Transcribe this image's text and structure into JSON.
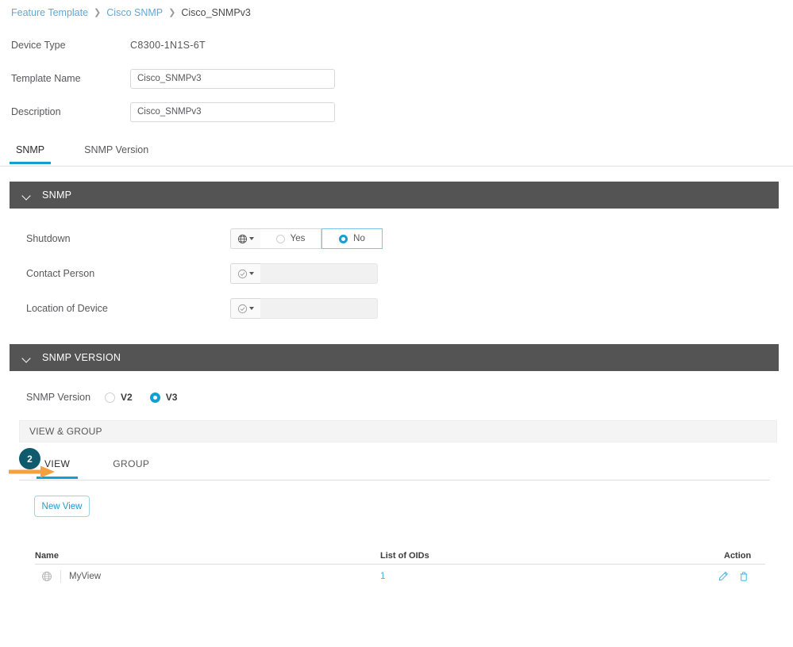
{
  "breadcrumb": {
    "items": [
      {
        "label": "Feature Template",
        "type": "link"
      },
      {
        "label": "Cisco SNMP",
        "type": "link"
      },
      {
        "label": "Cisco_SNMPv3",
        "type": "current"
      }
    ],
    "separator": "❯"
  },
  "meta": {
    "device_type_label": "Device Type",
    "device_type_value": "C8300-1N1S-6T",
    "template_name_label": "Template Name",
    "template_name_value": "Cisco_SNMPv3",
    "description_label": "Description",
    "description_value": "Cisco_SNMPv3"
  },
  "tabs": [
    {
      "label": "SNMP",
      "active": true
    },
    {
      "label": "SNMP Version",
      "active": false
    }
  ],
  "snmp_section": {
    "title": "SNMP",
    "shutdown": {
      "label": "Shutdown",
      "scope_icon": "globe-icon",
      "options": [
        {
          "label": "Yes",
          "selected": false
        },
        {
          "label": "No",
          "selected": true
        }
      ]
    },
    "contact_person": {
      "label": "Contact Person",
      "scope_icon": "check-circle-icon",
      "value": ""
    },
    "location_of_device": {
      "label": "Location of Device",
      "scope_icon": "check-circle-icon",
      "value": ""
    }
  },
  "version_section": {
    "title": "SNMP VERSION",
    "version_label": "SNMP Version",
    "versions": [
      {
        "label": "V2",
        "selected": false
      },
      {
        "label": "V3",
        "selected": true
      }
    ],
    "view_group_band": "VIEW & GROUP",
    "subtabs": [
      {
        "label": "VIEW",
        "active": true
      },
      {
        "label": "GROUP",
        "active": false
      }
    ],
    "new_view_button": "New View",
    "callout": {
      "number": "2"
    }
  },
  "table": {
    "columns": [
      "Name",
      "List of OIDs",
      "Action"
    ],
    "rows": [
      {
        "icon": "globe-icon",
        "name": "MyView",
        "oids": "1",
        "actions": [
          "edit-icon",
          "delete-icon"
        ]
      }
    ]
  },
  "colors": {
    "accent": "#12a0d1",
    "link": "#41b6e6",
    "breadcrumb_link": "#5fa8d9",
    "section_header_bg": "#545454",
    "callout_badge": "#105a6d",
    "callout_arrow": "#f5a03c"
  }
}
